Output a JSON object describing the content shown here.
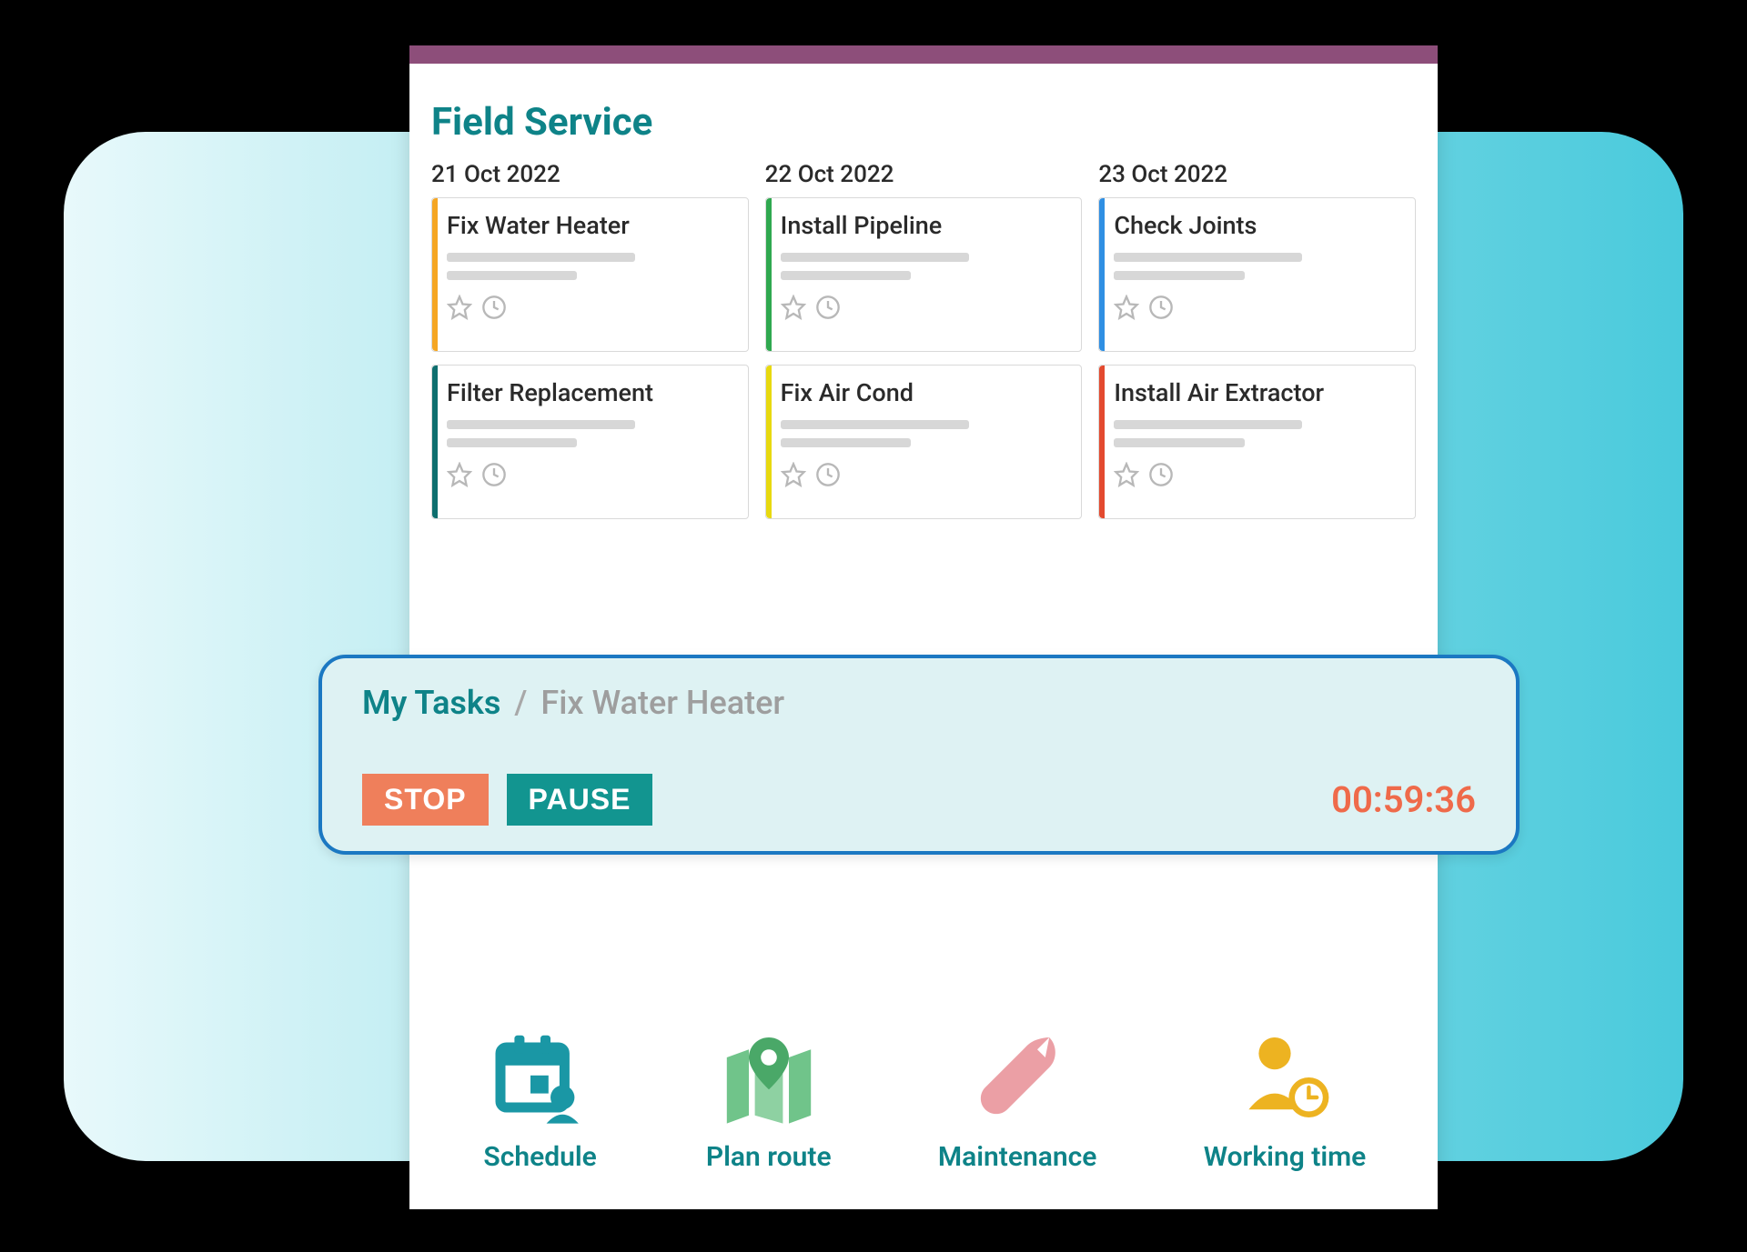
{
  "app": {
    "title": "Field Service"
  },
  "columns": [
    {
      "date": "21 Oct 2022",
      "cards": [
        {
          "title": "Fix Water Heater",
          "color": "orange"
        },
        {
          "title": "Filter Replacement",
          "color": "teal"
        }
      ]
    },
    {
      "date": "22 Oct 2022",
      "cards": [
        {
          "title": "Install Pipeline",
          "color": "green"
        },
        {
          "title": "Fix Air Cond",
          "color": "yellow"
        }
      ]
    },
    {
      "date": "23 Oct 2022",
      "cards": [
        {
          "title": "Check Joints",
          "color": "blue"
        },
        {
          "title": "Install Air Extractor",
          "color": "red"
        }
      ]
    }
  ],
  "task_panel": {
    "breadcrumb_primary": "My Tasks",
    "breadcrumb_sep": "/",
    "breadcrumb_secondary": "Fix Water Heater",
    "stop_label": "STOP",
    "pause_label": "PAUSE",
    "timer": "00:59:36"
  },
  "nav": [
    {
      "label": "Schedule",
      "icon": "calendar-user-icon",
      "color": "#1a97a5"
    },
    {
      "label": "Plan route",
      "icon": "map-pin-icon",
      "color": "#70c48a"
    },
    {
      "label": "Maintenance",
      "icon": "wrench-icon",
      "color": "#eb9fa5"
    },
    {
      "label": "Working time",
      "icon": "user-clock-icon",
      "color": "#edb321"
    }
  ]
}
